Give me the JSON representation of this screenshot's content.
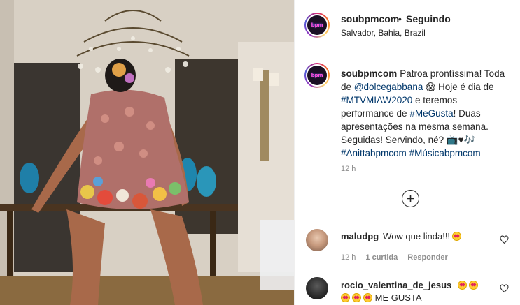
{
  "post": {
    "username": "soubpmcom",
    "separator": "•",
    "follow_status": "Seguindo",
    "location": "Salvador, Bahia, Brazil",
    "avatar_text": "bpm"
  },
  "caption": {
    "username": "soubpmcom",
    "text_1": "Patroa prontíssima! Toda de",
    "mention": "@dolcegabbana",
    "text_2": "Hoje é dia de",
    "hashtag_1": "#MTVMIAW2020",
    "text_3": "e teremos performance de",
    "hashtag_2": "#MeGusta",
    "text_4": "! Duas apresentações na mesma semana. Seguidas! Servindo, né?",
    "hashtag_3": "#Anittabpmcom",
    "hashtag_4": "#Músicabpmcom",
    "time": "12 h"
  },
  "icons": {
    "load_more": "plus-circle-icon",
    "like": "heart-outline-icon"
  },
  "comments": [
    {
      "username": "maludpg",
      "text": "Wow que linda!!!",
      "time": "12 h",
      "likes": "1 curtida",
      "reply": "Responder"
    },
    {
      "username": "rocio_valentina_de_jesus",
      "text": "ME GUSTA"
    }
  ],
  "colors": {
    "link": "#00376b",
    "muted": "#8e8e8e",
    "text": "#262626"
  }
}
